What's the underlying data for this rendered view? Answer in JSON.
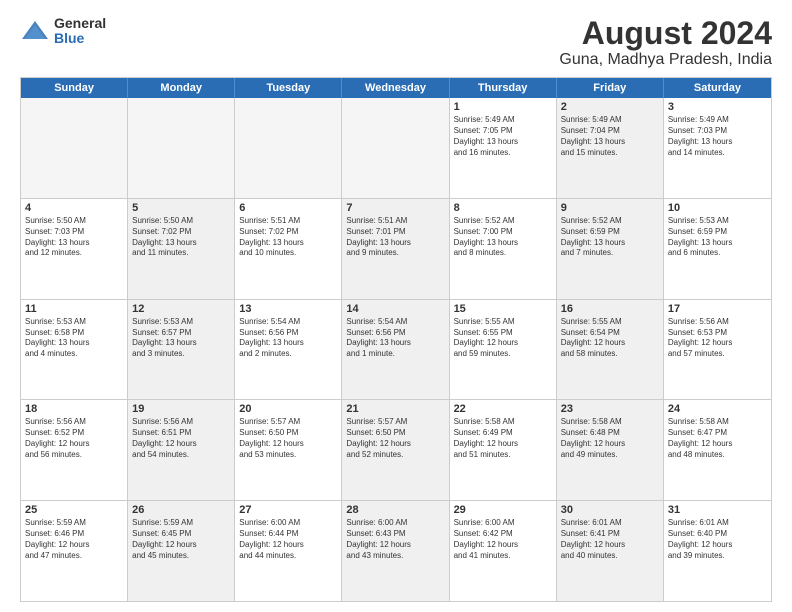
{
  "logo": {
    "general": "General",
    "blue": "Blue"
  },
  "title": "August 2024",
  "subtitle": "Guna, Madhya Pradesh, India",
  "days": [
    "Sunday",
    "Monday",
    "Tuesday",
    "Wednesday",
    "Thursday",
    "Friday",
    "Saturday"
  ],
  "weeks": [
    [
      {
        "day": "",
        "text": "",
        "empty": true
      },
      {
        "day": "",
        "text": "",
        "empty": true
      },
      {
        "day": "",
        "text": "",
        "empty": true
      },
      {
        "day": "",
        "text": "",
        "empty": true
      },
      {
        "day": "1",
        "text": "Sunrise: 5:49 AM\nSunset: 7:05 PM\nDaylight: 13 hours\nand 16 minutes.",
        "empty": false
      },
      {
        "day": "2",
        "text": "Sunrise: 5:49 AM\nSunset: 7:04 PM\nDaylight: 13 hours\nand 15 minutes.",
        "empty": false,
        "shaded": true
      },
      {
        "day": "3",
        "text": "Sunrise: 5:49 AM\nSunset: 7:03 PM\nDaylight: 13 hours\nand 14 minutes.",
        "empty": false
      }
    ],
    [
      {
        "day": "4",
        "text": "Sunrise: 5:50 AM\nSunset: 7:03 PM\nDaylight: 13 hours\nand 12 minutes.",
        "empty": false
      },
      {
        "day": "5",
        "text": "Sunrise: 5:50 AM\nSunset: 7:02 PM\nDaylight: 13 hours\nand 11 minutes.",
        "empty": false,
        "shaded": true
      },
      {
        "day": "6",
        "text": "Sunrise: 5:51 AM\nSunset: 7:02 PM\nDaylight: 13 hours\nand 10 minutes.",
        "empty": false
      },
      {
        "day": "7",
        "text": "Sunrise: 5:51 AM\nSunset: 7:01 PM\nDaylight: 13 hours\nand 9 minutes.",
        "empty": false,
        "shaded": true
      },
      {
        "day": "8",
        "text": "Sunrise: 5:52 AM\nSunset: 7:00 PM\nDaylight: 13 hours\nand 8 minutes.",
        "empty": false
      },
      {
        "day": "9",
        "text": "Sunrise: 5:52 AM\nSunset: 6:59 PM\nDaylight: 13 hours\nand 7 minutes.",
        "empty": false,
        "shaded": true
      },
      {
        "day": "10",
        "text": "Sunrise: 5:53 AM\nSunset: 6:59 PM\nDaylight: 13 hours\nand 6 minutes.",
        "empty": false
      }
    ],
    [
      {
        "day": "11",
        "text": "Sunrise: 5:53 AM\nSunset: 6:58 PM\nDaylight: 13 hours\nand 4 minutes.",
        "empty": false
      },
      {
        "day": "12",
        "text": "Sunrise: 5:53 AM\nSunset: 6:57 PM\nDaylight: 13 hours\nand 3 minutes.",
        "empty": false,
        "shaded": true
      },
      {
        "day": "13",
        "text": "Sunrise: 5:54 AM\nSunset: 6:56 PM\nDaylight: 13 hours\nand 2 minutes.",
        "empty": false
      },
      {
        "day": "14",
        "text": "Sunrise: 5:54 AM\nSunset: 6:56 PM\nDaylight: 13 hours\nand 1 minute.",
        "empty": false,
        "shaded": true
      },
      {
        "day": "15",
        "text": "Sunrise: 5:55 AM\nSunset: 6:55 PM\nDaylight: 12 hours\nand 59 minutes.",
        "empty": false
      },
      {
        "day": "16",
        "text": "Sunrise: 5:55 AM\nSunset: 6:54 PM\nDaylight: 12 hours\nand 58 minutes.",
        "empty": false,
        "shaded": true
      },
      {
        "day": "17",
        "text": "Sunrise: 5:56 AM\nSunset: 6:53 PM\nDaylight: 12 hours\nand 57 minutes.",
        "empty": false
      }
    ],
    [
      {
        "day": "18",
        "text": "Sunrise: 5:56 AM\nSunset: 6:52 PM\nDaylight: 12 hours\nand 56 minutes.",
        "empty": false
      },
      {
        "day": "19",
        "text": "Sunrise: 5:56 AM\nSunset: 6:51 PM\nDaylight: 12 hours\nand 54 minutes.",
        "empty": false,
        "shaded": true
      },
      {
        "day": "20",
        "text": "Sunrise: 5:57 AM\nSunset: 6:50 PM\nDaylight: 12 hours\nand 53 minutes.",
        "empty": false
      },
      {
        "day": "21",
        "text": "Sunrise: 5:57 AM\nSunset: 6:50 PM\nDaylight: 12 hours\nand 52 minutes.",
        "empty": false,
        "shaded": true
      },
      {
        "day": "22",
        "text": "Sunrise: 5:58 AM\nSunset: 6:49 PM\nDaylight: 12 hours\nand 51 minutes.",
        "empty": false
      },
      {
        "day": "23",
        "text": "Sunrise: 5:58 AM\nSunset: 6:48 PM\nDaylight: 12 hours\nand 49 minutes.",
        "empty": false,
        "shaded": true
      },
      {
        "day": "24",
        "text": "Sunrise: 5:58 AM\nSunset: 6:47 PM\nDaylight: 12 hours\nand 48 minutes.",
        "empty": false
      }
    ],
    [
      {
        "day": "25",
        "text": "Sunrise: 5:59 AM\nSunset: 6:46 PM\nDaylight: 12 hours\nand 47 minutes.",
        "empty": false
      },
      {
        "day": "26",
        "text": "Sunrise: 5:59 AM\nSunset: 6:45 PM\nDaylight: 12 hours\nand 45 minutes.",
        "empty": false,
        "shaded": true
      },
      {
        "day": "27",
        "text": "Sunrise: 6:00 AM\nSunset: 6:44 PM\nDaylight: 12 hours\nand 44 minutes.",
        "empty": false
      },
      {
        "day": "28",
        "text": "Sunrise: 6:00 AM\nSunset: 6:43 PM\nDaylight: 12 hours\nand 43 minutes.",
        "empty": false,
        "shaded": true
      },
      {
        "day": "29",
        "text": "Sunrise: 6:00 AM\nSunset: 6:42 PM\nDaylight: 12 hours\nand 41 minutes.",
        "empty": false
      },
      {
        "day": "30",
        "text": "Sunrise: 6:01 AM\nSunset: 6:41 PM\nDaylight: 12 hours\nand 40 minutes.",
        "empty": false,
        "shaded": true
      },
      {
        "day": "31",
        "text": "Sunrise: 6:01 AM\nSunset: 6:40 PM\nDaylight: 12 hours\nand 39 minutes.",
        "empty": false
      }
    ]
  ]
}
